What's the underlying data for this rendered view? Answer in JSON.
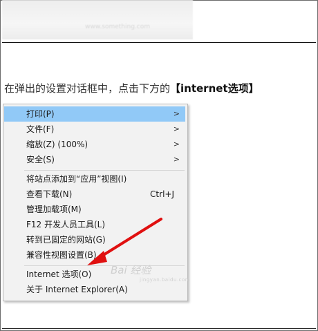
{
  "top_blur_text": "www.something.com",
  "instruction": {
    "prefix": "在弹出的设置对话框中，点击下方的",
    "highlight": "【internet选项】"
  },
  "menu": {
    "items": [
      {
        "label": "打印(P)",
        "arrow": ">"
      },
      {
        "label": "文件(F)",
        "arrow": ">"
      },
      {
        "label": "缩放(Z) (100%)",
        "arrow": ">"
      },
      {
        "label": "安全(S)",
        "arrow": ">"
      },
      {
        "label": "将站点添加到“应用”视图(I)"
      },
      {
        "label": "查看下载(N)",
        "shortcut": "Ctrl+J"
      },
      {
        "label": "管理加载项(M)"
      },
      {
        "label": "F12 开发人员工具(L)"
      },
      {
        "label": "转到已固定的网站(G)"
      },
      {
        "label": "兼容性视图设置(B)"
      },
      {
        "label": "Internet 选项(O)"
      },
      {
        "label": "关于 Internet Explorer(A)"
      }
    ]
  },
  "watermark": {
    "text": "Bai 经验",
    "sub": "jingyan.baidu.com"
  },
  "colors": {
    "highlight": "#91c9f7",
    "arrow": "#e01010"
  }
}
